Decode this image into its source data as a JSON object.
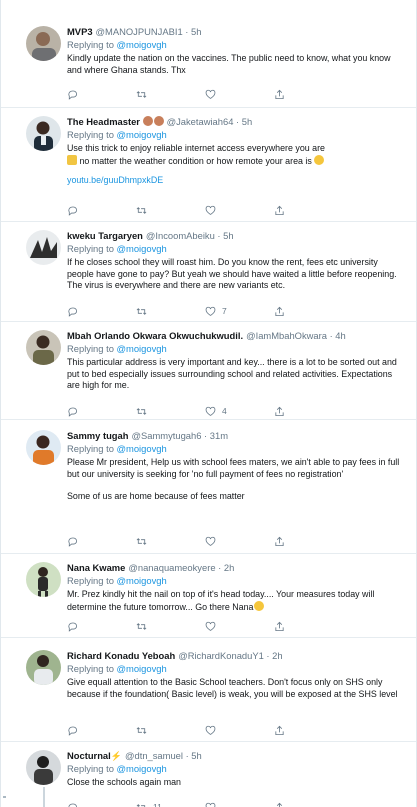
{
  "tweets": [
    {
      "name": "MVP3",
      "handle": "@MANOJPUNJABI1 · 5h",
      "replying_prefix": "Replying to ",
      "mention": "@moigovgh",
      "text": [
        "Kindly update the nation on the vaccines. The public need to know, what you know and where Ghana stands. Thx"
      ],
      "reply_count": "",
      "retweet_count": "",
      "like_count": ""
    },
    {
      "name": "The Headmaster",
      "handle": "@Jaketawiah64 · 5h",
      "replying_prefix": "Replying to ",
      "mention": "@moigovgh",
      "text": [
        "Use this trick to enjoy reliable internet access everywhere you are",
        "no matter the weather condition or how remote your area is"
      ],
      "link": "youtu.be/guuDhmpxkDE",
      "reply_count": "",
      "retweet_count": "",
      "like_count": ""
    },
    {
      "name": "kweku Targaryen",
      "handle": "@IncoomAbeiku · 5h",
      "replying_prefix": "Replying to ",
      "mention": "@moigovgh",
      "text": [
        "If he closes school they will roast him. Do you know the rent, fees etc university people have gone to pay? But yeah we should have waited a little before reopening. The virus is everywhere and there are new variants etc."
      ],
      "reply_count": "",
      "retweet_count": "",
      "like_count": "7"
    },
    {
      "name": "Mbah Orlando Okwara Okwuchukwudil.",
      "handle": "@IamMbahOkwara · 4h",
      "replying_prefix": "Replying to ",
      "mention": "@moigovgh",
      "text": [
        "This particular address is very important and key... there is a lot to be sorted out and put to bed especially issues surrounding school and related activities. Expectations are high for me."
      ],
      "reply_count": "",
      "retweet_count": "",
      "like_count": "4"
    },
    {
      "name": "Sammy tugah",
      "handle": "@Sammytugah6 · 31m",
      "replying_prefix": "Replying to ",
      "mention": "@moigovgh",
      "text": [
        "Please Mr president, Help us with school fees maters, we ain't able to pay fees in full but our university is seeking for 'no full payment of fees no registration'",
        "Some of us are home because of fees matter"
      ],
      "reply_count": "",
      "retweet_count": "",
      "like_count": ""
    },
    {
      "name": "Nana Kwame",
      "handle": "@nanaquameokyere · 2h",
      "replying_prefix": "Replying to ",
      "mention": "@moigovgh",
      "text": [
        "Mr. Prez kindly hit the nail on top of it's head today.... Your measures today will determine the future tomorrow... Go there Nana"
      ],
      "reply_count": "",
      "retweet_count": "",
      "like_count": ""
    },
    {
      "name": "Richard Konadu Yeboah",
      "handle": "@RichardKonaduY1 · 2h",
      "replying_prefix": "Replying to ",
      "mention": "@moigovgh",
      "text": [
        "Give equall attention to the Basic School teachers. Don't focus only on SHS only because if the foundation( Basic level) is weak, you will be exposed at the SHS level"
      ],
      "reply_count": "",
      "retweet_count": "",
      "like_count": ""
    },
    {
      "name": "Nocturnal",
      "handle": "@dtn_samuel · 5h",
      "replying_prefix": "Replying to ",
      "mention": "@moigovgh",
      "text": [
        "Close the schools again man"
      ],
      "reply_count": "",
      "retweet_count": "11",
      "like_count": ""
    }
  ],
  "icons": {
    "reply": "reply-icon",
    "retweet": "retweet-icon",
    "like": "heart-icon",
    "share": "share-icon"
  },
  "colors": {
    "link": "#1b95e0",
    "muted": "#657786",
    "divider": "#e6ecf0"
  }
}
